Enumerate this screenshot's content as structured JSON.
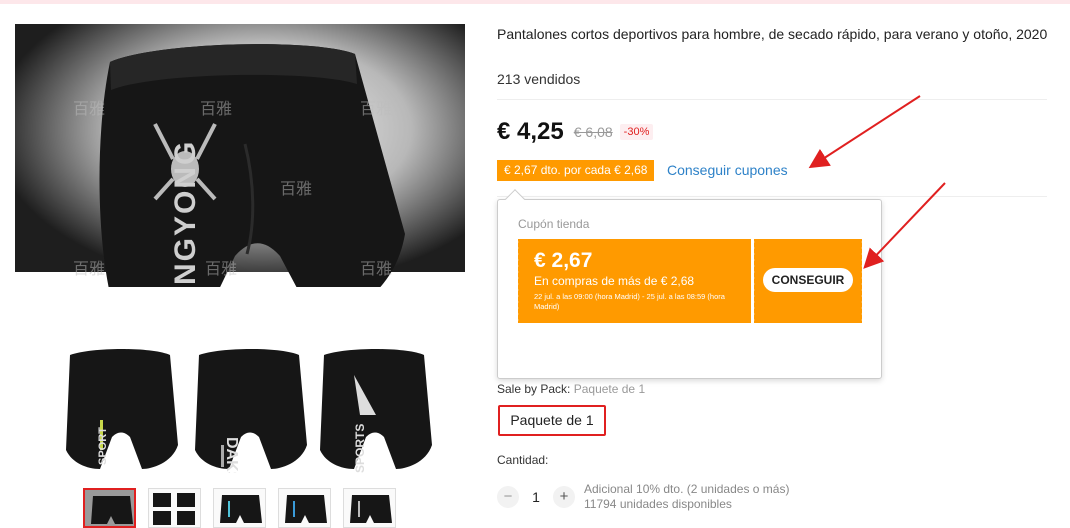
{
  "product": {
    "title": "Pantalones cortos deportivos para hombre, de secado rápido, para verano y otoño, 2020",
    "sold": "213 vendidos",
    "price": "€ 4,25",
    "old_price": "€ 6,08",
    "discount": "-30%",
    "coupon_tag": "€ 2,67 dto. por cada € 2,68",
    "get_coupons_link": "Conseguir cupones"
  },
  "coupon_popup": {
    "label": "Cupón tienda",
    "amount": "€ 2,67",
    "condition": "En compras de más de € 2,68",
    "dates": "22 jul. a las 09:00 (hora Madrid) - 25 jul. a las 08:59 (hora Madrid)",
    "button": "CONSEGUIR"
  },
  "variants": {
    "sale_label": "Sale by Pack:",
    "sale_value": "Paquete de 1",
    "option": "Paquete de 1"
  },
  "quantity": {
    "label": "Cantidad:",
    "value": "1",
    "minus": "−",
    "plus": "+",
    "extra_discount": "Adicional 10% dto. (2 unidades o más)",
    "available": "11794 unidades disponibles"
  },
  "gallery": {
    "brand_text": "JINGYONG",
    "thumb_texts": [
      "SPORT",
      "DAKS",
      "SPORTS"
    ],
    "watermark": "百雅"
  },
  "colors": {
    "accent_orange": "#ff9a00",
    "sale_red": "#e02020",
    "link_blue": "#2e82c8"
  }
}
